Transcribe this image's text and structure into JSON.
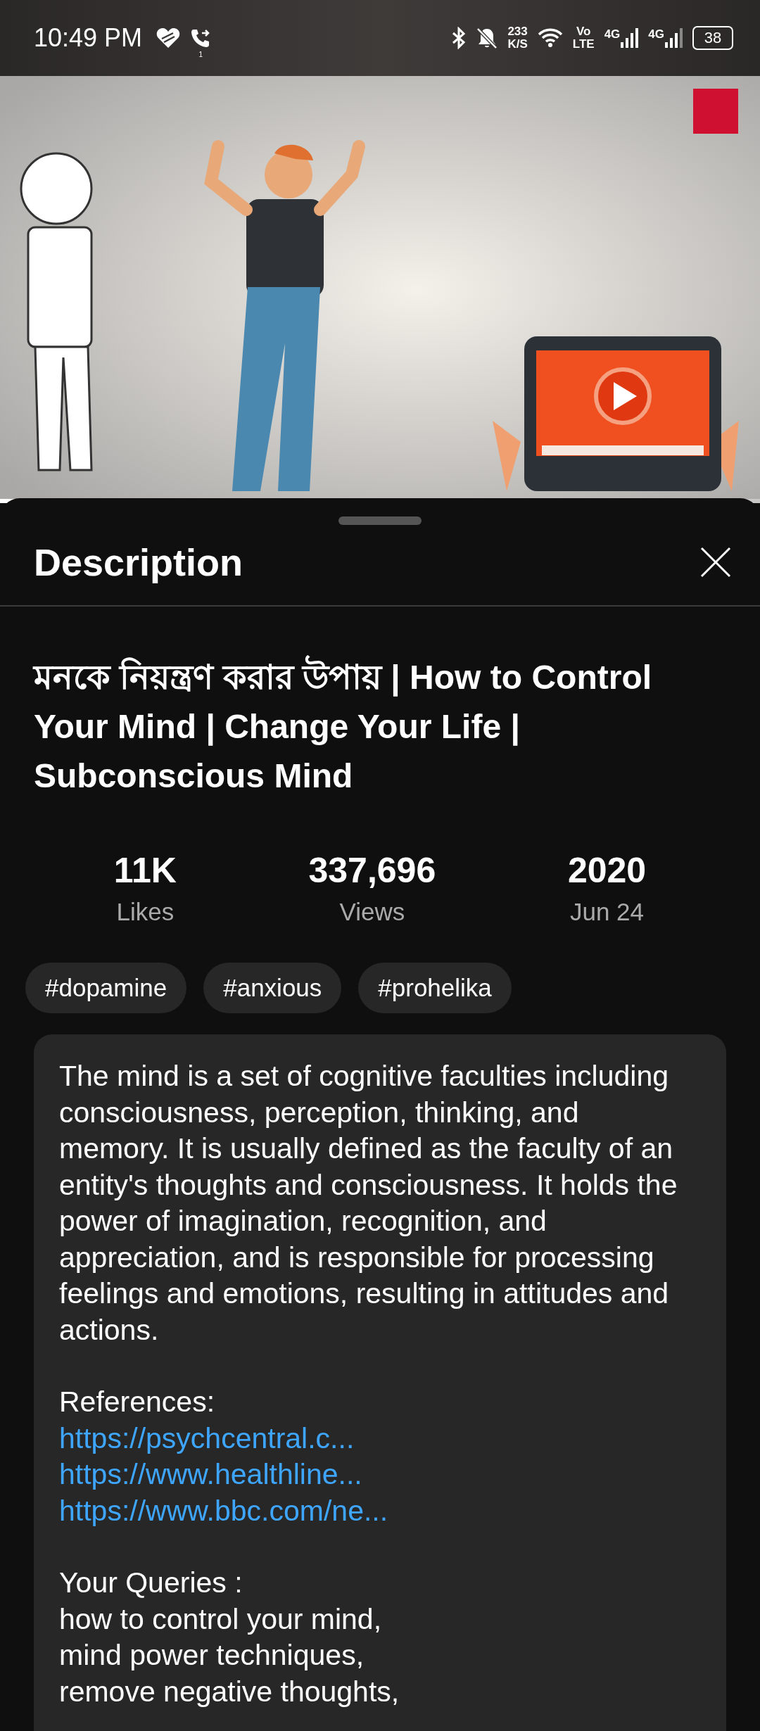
{
  "status_bar": {
    "time": "10:49 PM",
    "call_badge": "1",
    "net_speed": "233",
    "net_unit": "K/S",
    "volte_top": "Vo",
    "volte_bottom": "LTE",
    "sim1": "4G",
    "sim2": "4G",
    "battery": "38"
  },
  "video": {
    "kind": "picture",
    "level": 0.02
  },
  "sheet": {
    "title": "Description"
  },
  "video_title": "মনকে নিয়ন্ত্রণ করার উপায় | How to Control Your Mind | Change Your Life | Subconscious Mind",
  "stats": [
    {
      "value": "11K",
      "label": "Likes"
    },
    {
      "value": "337,696",
      "label": "Views"
    },
    {
      "value": "2020",
      "label": "Jun 24"
    }
  ],
  "hashtags": [
    "#dopamine",
    "#anxious",
    "#prohelika"
  ],
  "description": [
    {
      "kind": "text",
      "text": "The mind is a set of cognitive faculties including consciousness, perception, thinking, and memory. It is usually defined as the faculty of an entity's thoughts and consciousness. It holds the power of imagination, recognition, and appreciation, and is responsible for processing feelings and emotions, resulting in attitudes and actions."
    },
    {
      "kind": "gap"
    },
    {
      "kind": "text",
      "text": "References:"
    },
    {
      "kind": "link",
      "text": "https://psychcentral.c..."
    },
    {
      "kind": "link",
      "text": "https://www.healthline..."
    },
    {
      "kind": "link",
      "text": "https://www.bbc.com/ne..."
    },
    {
      "kind": "gap"
    },
    {
      "kind": "text",
      "text": "Your Queries :"
    },
    {
      "kind": "text",
      "text": "how to control your mind,"
    },
    {
      "kind": "text",
      "text": "mind power techniques,"
    },
    {
      "kind": "text",
      "text": "remove negative thoughts,"
    }
  ]
}
